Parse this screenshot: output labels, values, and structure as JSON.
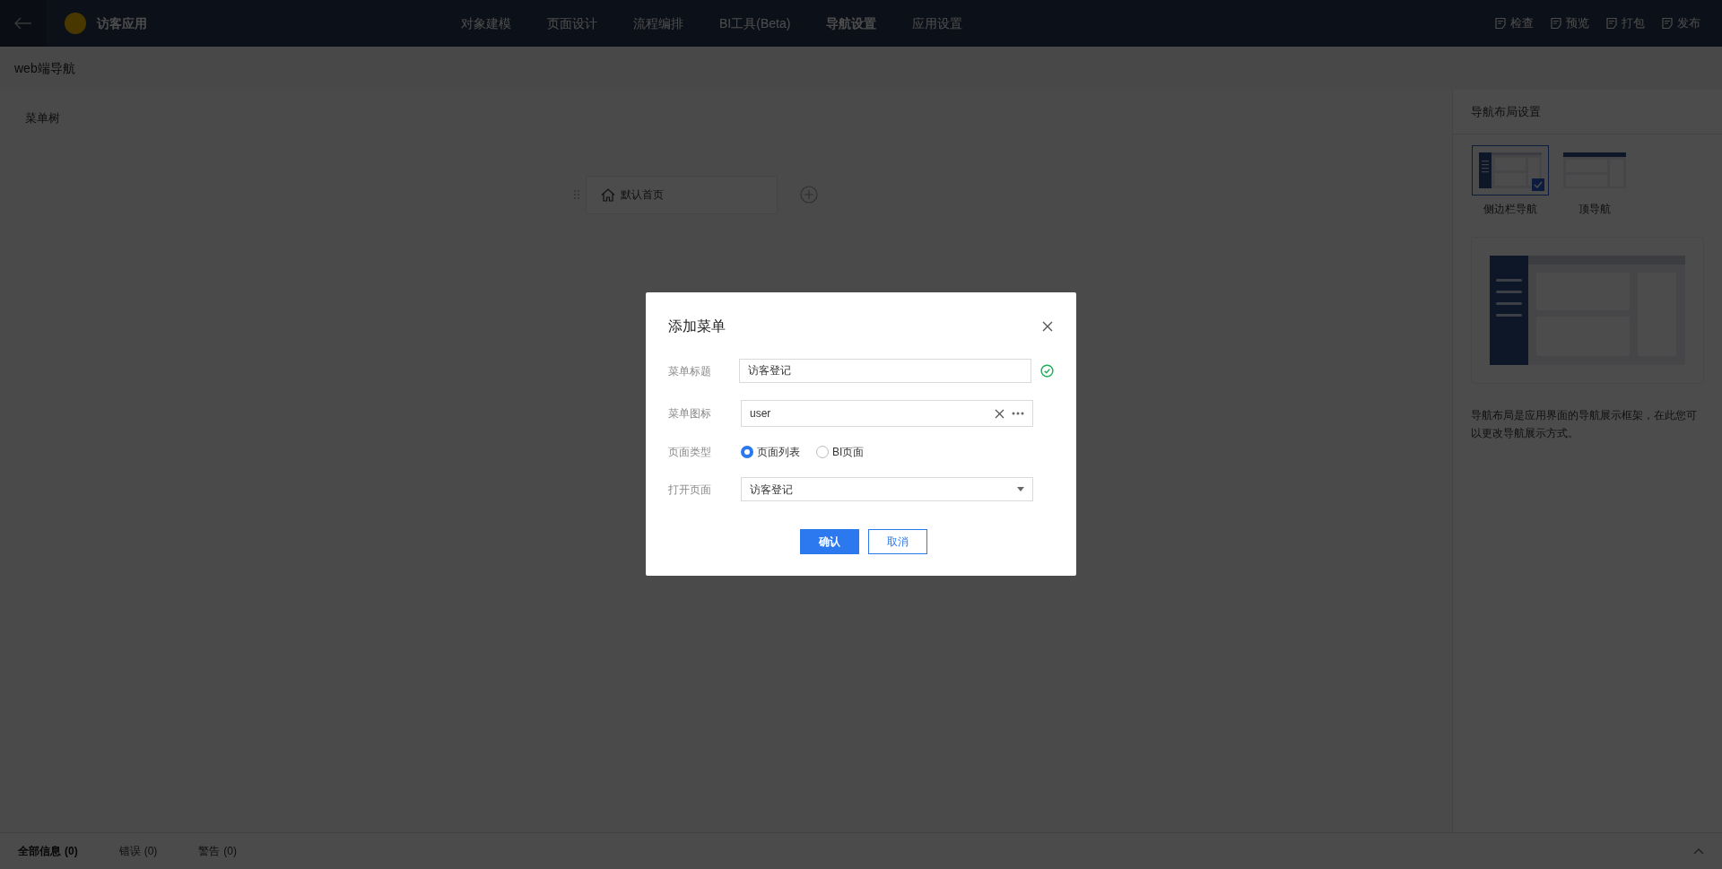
{
  "header": {
    "app_name": "访客应用",
    "tabs": [
      {
        "label": "对象建模",
        "selected": false
      },
      {
        "label": "页面设计",
        "selected": false
      },
      {
        "label": "流程编排",
        "selected": false
      },
      {
        "label": "BI工具(Beta)",
        "selected": false
      },
      {
        "label": "导航设置",
        "selected": true
      },
      {
        "label": "应用设置",
        "selected": false
      }
    ],
    "actions": [
      "检查",
      "预览",
      "打包",
      "发布"
    ]
  },
  "page_title": "web端导航",
  "menu_tree": {
    "title": "菜单树",
    "items": [
      {
        "label": "默认首页"
      }
    ]
  },
  "right_panel": {
    "title": "导航布局设置",
    "layouts": [
      {
        "kind": "side",
        "label": "侧边栏导航",
        "selected": true
      },
      {
        "kind": "top",
        "label": "顶导航",
        "selected": false
      }
    ],
    "description": "导航布局是应用界面的导航展示框架，在此您可以更改导航展示方式。"
  },
  "bottom_bar": {
    "tabs": [
      {
        "label": "全部信息",
        "count": "(0)",
        "selected": true
      },
      {
        "label": "错误",
        "count": "(0)",
        "selected": false
      },
      {
        "label": "警告",
        "count": "(0)",
        "selected": false
      }
    ]
  },
  "dialog": {
    "title": "添加菜单",
    "fields": [
      {
        "kind": "text",
        "label": "菜单标题",
        "value": "访客登记",
        "valid": true
      },
      {
        "kind": "icon",
        "label": "菜单图标",
        "value": "user"
      },
      {
        "kind": "radio",
        "label": "页面类型",
        "options": [
          {
            "label": "页面列表",
            "selected": true
          },
          {
            "label": "BI页面",
            "selected": false
          }
        ]
      },
      {
        "kind": "select",
        "label": "打开页面",
        "value": "访客登记"
      }
    ],
    "buttons": [
      {
        "kind": "primary",
        "label": "确认"
      },
      {
        "kind": "secondary",
        "label": "取消"
      }
    ]
  }
}
